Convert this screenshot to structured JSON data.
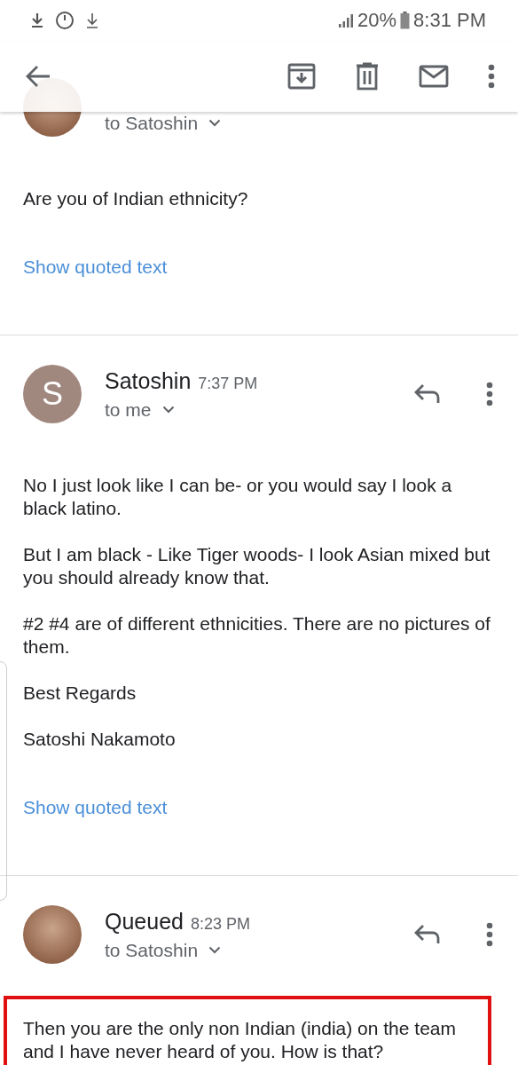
{
  "status_bar": {
    "battery": "20%",
    "time": "8:31 PM"
  },
  "messages": [
    {
      "recipient": "to Satoshin",
      "avatar": {
        "kind": "photo"
      },
      "body": [
        "Are you of Indian ethnicity?"
      ],
      "link": "Show quoted text",
      "highlighted": false
    },
    {
      "sender": "Satoshin",
      "time": "7:37 PM",
      "recipient": "to me",
      "avatar": {
        "kind": "letter",
        "letter": "S"
      },
      "body": [
        "No I just look like I can be- or you would say I look a black latino.",
        "But I am black - Like Tiger woods- I look Asian mixed but you should already know that.",
        "#2 #4 are of different ethnicities. There are no pictures of them.",
        "Best Regards",
        "Satoshi Nakamoto"
      ],
      "link": "Show quoted text",
      "highlighted": false
    },
    {
      "sender": "Queued",
      "time": "8:23 PM",
      "recipient": "to Satoshin",
      "avatar": {
        "kind": "photo"
      },
      "body": [
        "Then you are the only non Indian (india) on the team and I have never heard of you. How is that?"
      ],
      "highlighted": true
    }
  ]
}
